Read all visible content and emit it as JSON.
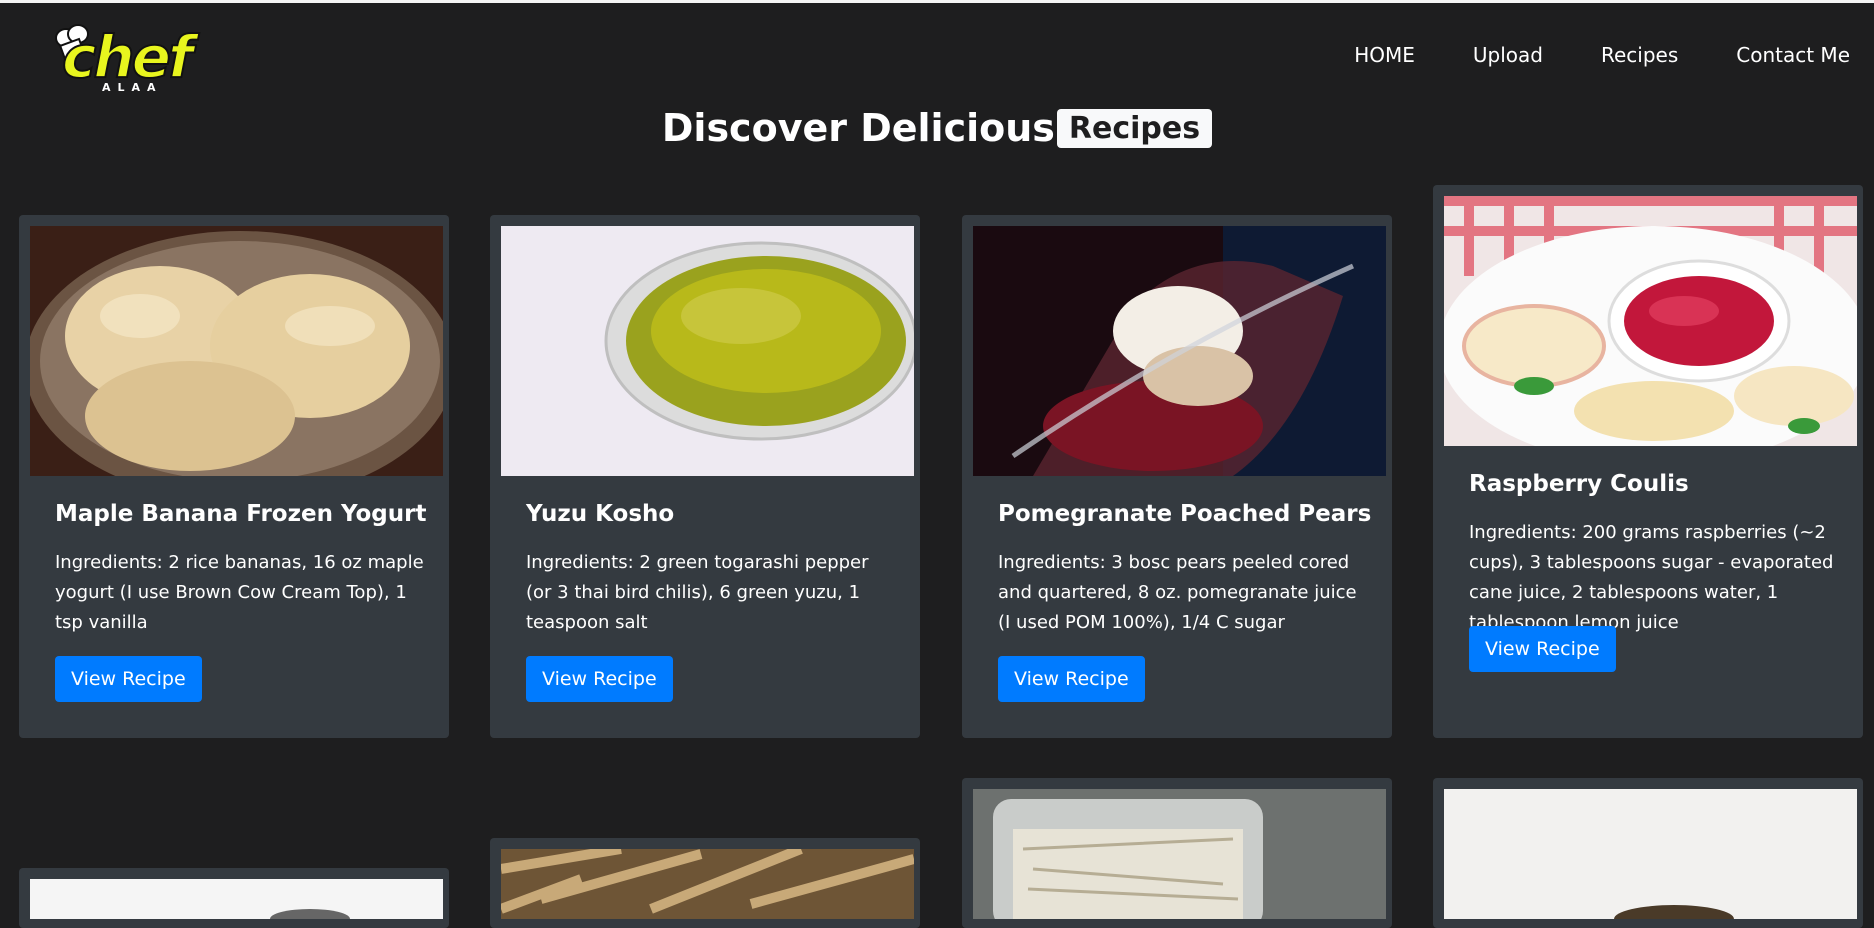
{
  "brand": {
    "logo_word": "chef",
    "logo_sub": "ALAA"
  },
  "nav": {
    "items": [
      {
        "label": "HOME"
      },
      {
        "label": "Upload"
      },
      {
        "label": "Recipes"
      },
      {
        "label": "Contact Me"
      }
    ]
  },
  "heading": {
    "text": "Discover Delicious",
    "tag": "Recipes"
  },
  "cards": [
    {
      "title": "Maple Banana Frozen Yogurt",
      "ingredients": "Ingredients: 2 rice bananas, 16 oz maple yogurt (I use Brown Cow Cream Top), 1 tsp vanilla",
      "button": "View Recipe",
      "image": "frozen-yogurt-photo"
    },
    {
      "title": "Yuzu Kosho",
      "ingredients": "Ingredients: 2 green togarashi pepper (or 3 thai bird chilis), 6 green yuzu, 1 teaspoon salt",
      "button": "View Recipe",
      "image": "yuzu-sauce-photo"
    },
    {
      "title": "Pomegranate Poached Pears",
      "ingredients": "Ingredients: 3 bosc pears peeled cored and quartered, 8 oz. pomegranate juice (I used POM 100%), 1/4 C sugar",
      "button": "View Recipe",
      "image": "poached-pears-photo"
    },
    {
      "title": "Raspberry Coulis",
      "ingredients": "Ingredients: 200 grams raspberries (~2 cups), 3 tablespoons sugar - evaporated cane juice, 2 tablespoons water, 1 tablespoon lemon juice",
      "button": "View Recipe",
      "image": "raspberry-coulis-photo"
    }
  ],
  "colors": {
    "background": "#1e1e1f",
    "card": "#343a40",
    "button": "#007bff",
    "logo": "#e8f51e"
  }
}
